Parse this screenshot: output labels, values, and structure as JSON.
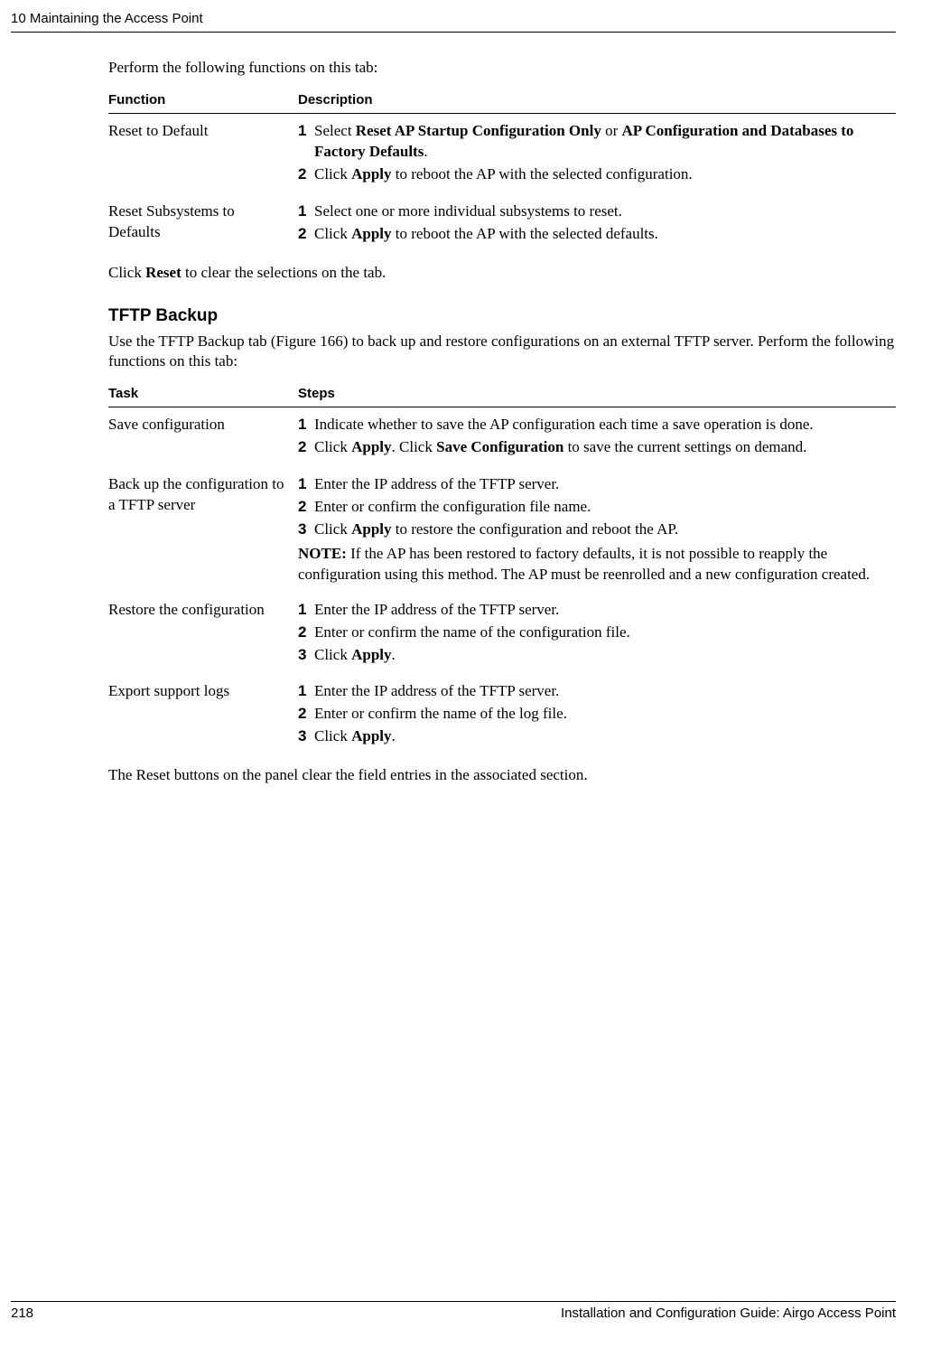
{
  "header": {
    "chapter": "10  Maintaining the Access Point"
  },
  "intro1": "Perform the following functions on this tab:",
  "table1": {
    "head": {
      "c1": "Function",
      "c2": "Description"
    },
    "rows": [
      {
        "c1": "Reset to Default",
        "steps": [
          {
            "n": "1",
            "pre": "Select ",
            "b1": "Reset AP Startup Configuration Only",
            "mid": " or ",
            "b2": "AP Configuration and Databases to Factory Defaults",
            "post": "."
          },
          {
            "n": "2",
            "pre": "Click ",
            "b1": "Apply",
            "mid": " to reboot the AP with the selected configuration.",
            "b2": "",
            "post": ""
          }
        ]
      },
      {
        "c1": "Reset Subsystems to Defaults",
        "steps": [
          {
            "n": "1",
            "pre": "Select one or more individual subsystems to reset.",
            "b1": "",
            "mid": "",
            "b2": "",
            "post": ""
          },
          {
            "n": "2",
            "pre": "Click ",
            "b1": "Apply",
            "mid": " to reboot the AP with the selected defaults.",
            "b2": "",
            "post": ""
          }
        ]
      }
    ]
  },
  "afterTable1_pre": "Click ",
  "afterTable1_b": "Reset",
  "afterTable1_post": " to clear the selections on the tab.",
  "h2": "TFTP Backup",
  "intro2": "Use the TFTP Backup tab (Figure 166) to back up and restore configurations on an external TFTP server. Perform the following functions on this tab:",
  "table2": {
    "head": {
      "c1": "Task",
      "c2": "Steps"
    },
    "rows": [
      {
        "c1": "Save configuration",
        "steps": [
          {
            "n": "1",
            "pre": "Indicate whether to save the AP configuration each time a save operation is done.",
            "b1": "",
            "mid": "",
            "b2": "",
            "post": ""
          },
          {
            "n": "2",
            "pre": "Click ",
            "b1": "Apply",
            "mid": ". Click ",
            "b2": "Save Configuration",
            "post": " to save the current settings on demand."
          }
        ],
        "note": ""
      },
      {
        "c1": "Back up the configuration to a TFTP server",
        "steps": [
          {
            "n": "1",
            "pre": "Enter the IP address of the TFTP server.",
            "b1": "",
            "mid": "",
            "b2": "",
            "post": ""
          },
          {
            "n": "2",
            "pre": "Enter or confirm the configuration file name.",
            "b1": "",
            "mid": "",
            "b2": "",
            "post": ""
          },
          {
            "n": "3",
            "pre": "Click ",
            "b1": "Apply",
            "mid": " to restore the configuration and reboot the AP.",
            "b2": "",
            "post": ""
          }
        ],
        "note_label": "NOTE:",
        "note": " If the AP has been restored to factory defaults, it is not possible to reapply the configuration using this method. The AP must be reenrolled and a new configuration created."
      },
      {
        "c1": "Restore the configuration",
        "steps": [
          {
            "n": "1",
            "pre": "Enter the IP address of the TFTP server.",
            "b1": "",
            "mid": "",
            "b2": "",
            "post": ""
          },
          {
            "n": "2",
            "pre": "Enter or confirm the name of the configuration file.",
            "b1": "",
            "mid": "",
            "b2": "",
            "post": ""
          },
          {
            "n": "3",
            "pre": "Click ",
            "b1": "Apply",
            "mid": ".",
            "b2": "",
            "post": ""
          }
        ],
        "note": ""
      },
      {
        "c1": "Export support logs",
        "steps": [
          {
            "n": "1",
            "pre": "Enter the IP address of the TFTP server.",
            "b1": "",
            "mid": "",
            "b2": "",
            "post": ""
          },
          {
            "n": "2",
            "pre": "Enter or confirm the name of the log file.",
            "b1": "",
            "mid": "",
            "b2": "",
            "post": ""
          },
          {
            "n": "3",
            "pre": "Click ",
            "b1": "Apply",
            "mid": ".",
            "b2": "",
            "post": ""
          }
        ],
        "note": ""
      }
    ]
  },
  "afterTable2": "The Reset buttons on the panel clear the field entries in the associated section.",
  "footer": {
    "page": "218",
    "doc": "Installation and Configuration Guide: Airgo Access Point"
  }
}
